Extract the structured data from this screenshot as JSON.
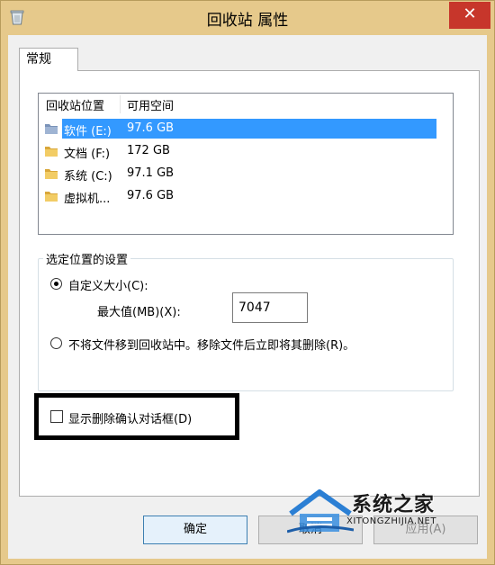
{
  "window": {
    "title": "回收站 属性",
    "close_glyph": "✕"
  },
  "tabs": [
    {
      "label": "常规"
    }
  ],
  "listview": {
    "columns": [
      "回收站位置",
      "可用空间"
    ],
    "rows": [
      {
        "name": "软件 (E:)",
        "space": "97.6 GB",
        "selected": true
      },
      {
        "name": "文档 (F:)",
        "space": "172 GB",
        "selected": false
      },
      {
        "name": "系统 (C:)",
        "space": "97.1 GB",
        "selected": false
      },
      {
        "name": "虚拟机...",
        "space": "97.6 GB",
        "selected": false
      }
    ]
  },
  "settings": {
    "group_title": "选定位置的设置",
    "custom_size_label": "自定义大小(C):",
    "custom_size_checked": true,
    "max_value_label": "最大值(MB)(X):",
    "max_value": "7047",
    "no_move_label": "不将文件移到回收站中。移除文件后立即将其删除(R)。",
    "no_move_checked": false,
    "confirm_label": "显示删除确认对话框(D)",
    "confirm_checked": false
  },
  "buttons": {
    "ok": "确定",
    "cancel": "取消",
    "apply": "应用(A)"
  },
  "watermark": {
    "brand": "系统之家",
    "url": "XITONGZHIJIA.NET"
  },
  "colors": {
    "selection": "#3399ff",
    "close_button": "#c7362b",
    "frame": "#e6c98b"
  },
  "icons": [
    "recycle-bin-icon",
    "close-icon",
    "folder-icon"
  ]
}
